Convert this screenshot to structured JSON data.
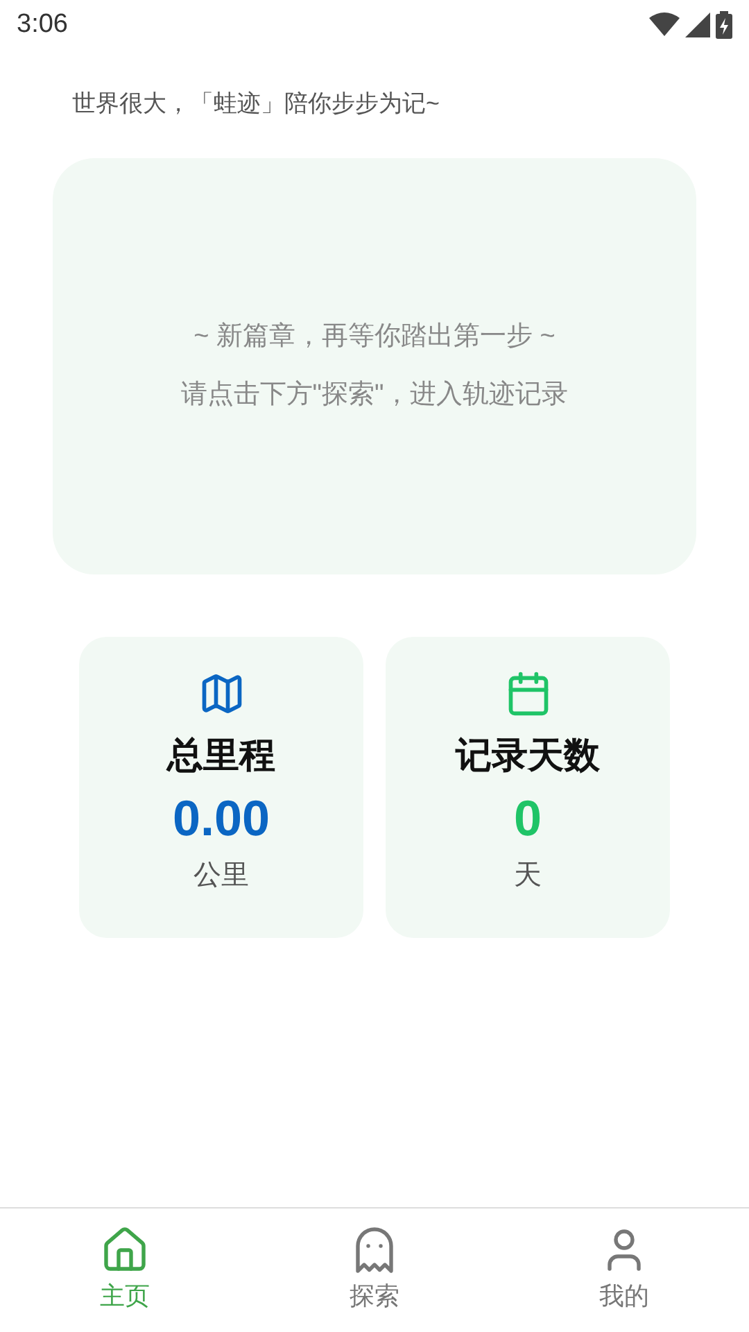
{
  "status_bar": {
    "time": "3:06"
  },
  "tagline": "世界很大，「蛙迹」陪你步步为记~",
  "empty_card": {
    "title": "~ 新篇章，再等你踏出第一步 ~",
    "hint": "请点击下方\"探索\"，进入轨迹记录"
  },
  "stats": [
    {
      "kind": "distance",
      "label": "总里程",
      "value": "0.00",
      "unit": "公里",
      "color": "#0b66c3"
    },
    {
      "kind": "days",
      "label": "记录天数",
      "value": "0",
      "unit": "天",
      "color": "#1fc467"
    }
  ],
  "tabs": [
    {
      "kind": "home",
      "label": "主页",
      "selected": true
    },
    {
      "kind": "explore",
      "label": "探索",
      "selected": false
    },
    {
      "kind": "me",
      "label": "我的",
      "selected": false
    }
  ]
}
